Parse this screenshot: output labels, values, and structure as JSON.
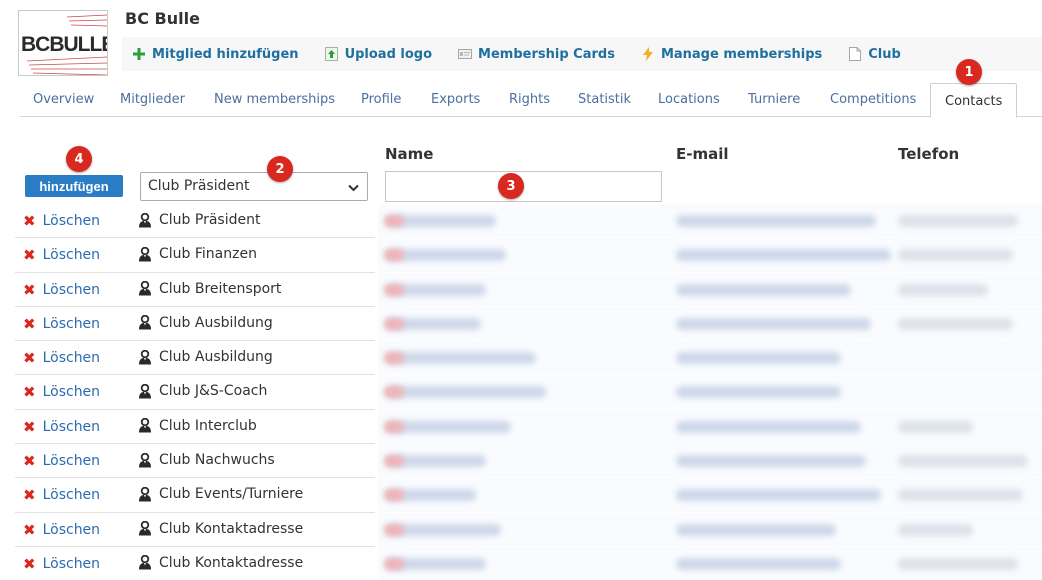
{
  "header": {
    "club_name": "BC Bulle",
    "logo_text": "BCBULLE"
  },
  "actions": [
    {
      "label": "Mitglied hinzufügen",
      "icon": "plus-icon",
      "color": "#2e9c3a"
    },
    {
      "label": "Upload logo",
      "icon": "upload-icon",
      "color": "#2e9c3a"
    },
    {
      "label": "Membership Cards",
      "icon": "card-icon",
      "color": "#9a9a9a"
    },
    {
      "label": "Manage memberships",
      "icon": "lightning-icon",
      "color": "#f2b01e"
    },
    {
      "label": "Club",
      "icon": "document-icon",
      "color": "#9a9a9a"
    }
  ],
  "tabs": [
    {
      "label": "Overview"
    },
    {
      "label": "Mitglieder"
    },
    {
      "label": "New memberships"
    },
    {
      "label": "Profile"
    },
    {
      "label": "Exports"
    },
    {
      "label": "Rights"
    },
    {
      "label": "Statistik"
    },
    {
      "label": "Locations"
    },
    {
      "label": "Turniere"
    },
    {
      "label": "Competitions"
    },
    {
      "label": "Contacts",
      "active": true
    }
  ],
  "table": {
    "columns": {
      "name": "Name",
      "email": "E-mail",
      "phone": "Telefon"
    },
    "add_label": "hinzufügen",
    "role_select_value": "Club Präsident",
    "name_input_value": "",
    "delete_label": "Löschen",
    "rows": [
      {
        "role": "Club Präsident"
      },
      {
        "role": "Club Finanzen"
      },
      {
        "role": "Club Breitensport"
      },
      {
        "role": "Club Ausbildung"
      },
      {
        "role": "Club Ausbildung"
      },
      {
        "role": "Club J&S-Coach"
      },
      {
        "role": "Club Interclub"
      },
      {
        "role": "Club Nachwuchs"
      },
      {
        "role": "Club Events/Turniere"
      },
      {
        "role": "Club Kontaktadresse"
      },
      {
        "role": "Club Kontaktadresse"
      }
    ]
  },
  "markers": [
    "1",
    "2",
    "3",
    "4"
  ],
  "colors": {
    "accent": "#2a7cc4",
    "delete": "#d9281f",
    "marker": "#d9281f",
    "link": "#4a6fa0"
  }
}
